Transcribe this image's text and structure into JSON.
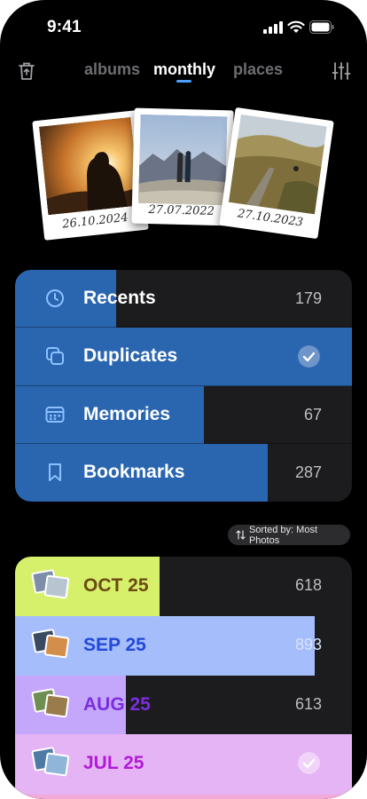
{
  "status": {
    "time": "9:41"
  },
  "header": {
    "tabs": [
      {
        "label": "albums",
        "active": false
      },
      {
        "label": "monthly",
        "active": true
      },
      {
        "label": "places",
        "active": false
      }
    ],
    "accent": "#4da2ff"
  },
  "polaroids": [
    {
      "caption": "26.10.2024"
    },
    {
      "caption": "27.07.2022"
    },
    {
      "caption": "27.10.2023"
    }
  ],
  "albums": [
    {
      "label": "Recents",
      "count": "179",
      "icon": "clock-icon",
      "fill": 0.3,
      "color": "#2a66b0"
    },
    {
      "label": "Duplicates",
      "count": "",
      "icon": "duplicate-icon",
      "fill": 1.0,
      "color": "#2a66b0",
      "checked": true
    },
    {
      "label": "Memories",
      "count": "67",
      "icon": "calendar-icon",
      "fill": 0.56,
      "color": "#2a66b0"
    },
    {
      "label": "Bookmarks",
      "count": "287",
      "icon": "bookmark-icon",
      "fill": 0.75,
      "color": "#2a66b0"
    }
  ],
  "sort": {
    "label": "Sorted by: Most Photos"
  },
  "months": [
    {
      "label": "OCT 25",
      "count": "618",
      "fill": 0.43,
      "color": "#d7f06c",
      "text_color": "#6b4a12"
    },
    {
      "label": "SEP 25",
      "count": "893",
      "fill": 0.89,
      "color": "#a5bdfb",
      "text_color": "#2349d8"
    },
    {
      "label": "AUG 25",
      "count": "613",
      "fill": 0.33,
      "color": "#c4a6fa",
      "text_color": "#7b2ee0"
    },
    {
      "label": "JUL 25",
      "count": "",
      "fill": 1.0,
      "color": "#e4b4f5",
      "text_color": "#b21ad6",
      "checked": true
    }
  ]
}
